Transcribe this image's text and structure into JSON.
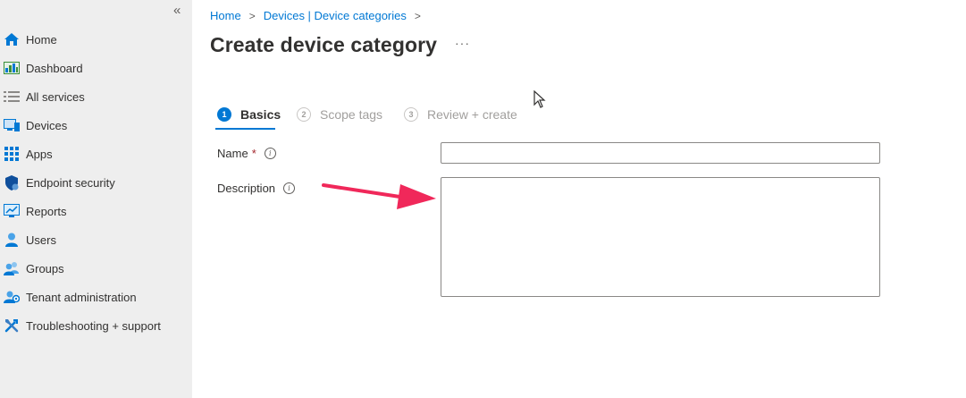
{
  "sidebar": {
    "collapse_glyph": "«",
    "items": [
      {
        "label": "Home",
        "icon": "home-icon"
      },
      {
        "label": "Dashboard",
        "icon": "dashboard-icon"
      },
      {
        "label": "All services",
        "icon": "list-icon"
      },
      {
        "label": "Devices",
        "icon": "devices-icon"
      },
      {
        "label": "Apps",
        "icon": "apps-icon"
      },
      {
        "label": "Endpoint security",
        "icon": "shield-icon"
      },
      {
        "label": "Reports",
        "icon": "reports-icon"
      },
      {
        "label": "Users",
        "icon": "user-icon"
      },
      {
        "label": "Groups",
        "icon": "groups-icon"
      },
      {
        "label": "Tenant administration",
        "icon": "tenant-admin-icon"
      },
      {
        "label": "Troubleshooting + support",
        "icon": "tools-icon"
      }
    ]
  },
  "breadcrumb": {
    "items": [
      "Home",
      "Devices | Device categories"
    ],
    "separator": ">"
  },
  "page": {
    "title": "Create device category",
    "more": "···"
  },
  "steps": [
    {
      "number": "1",
      "label": "Basics",
      "state": "active"
    },
    {
      "number": "2",
      "label": "Scope tags",
      "state": "inactive"
    },
    {
      "number": "3",
      "label": "Review + create",
      "state": "inactive"
    }
  ],
  "form": {
    "name_label": "Name",
    "required_mark": "*",
    "info_glyph": "i",
    "name_value": "",
    "description_label": "Description",
    "description_value": ""
  },
  "colors": {
    "accent": "#0078d4",
    "sidebar_bg": "#eeeeee",
    "arrow": "#f0285a"
  }
}
